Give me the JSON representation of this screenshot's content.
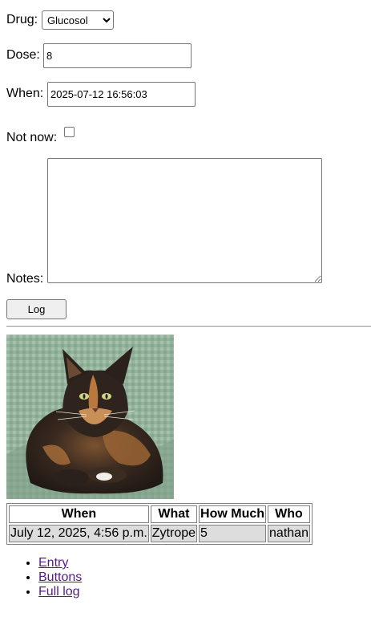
{
  "form": {
    "drug_label": "Drug:",
    "drug_selected": "Glucosol",
    "dose_label": "Dose:",
    "dose_value": "8",
    "when_label": "When:",
    "when_value": "2025-07-12 16:56:03",
    "not_now_label": "Not now:",
    "not_now_checked": false,
    "notes_label": "Notes:",
    "notes_value": "",
    "log_button": "Log"
  },
  "photo": {
    "subject": "tortoiseshell long-haired cat on a green blanket",
    "colors": {
      "blanket": "#8fae98",
      "fur_dark": "#2a211c",
      "fur_orange": "#b9793e",
      "fur_light": "#f3efe8",
      "eyes": "#cfd58a"
    }
  },
  "log_table": {
    "headers": [
      "When",
      "What",
      "How Much",
      "Who"
    ],
    "rows": [
      [
        "July 12, 2025, 4:56 p.m.",
        "Zytrope",
        "5",
        "nathan"
      ]
    ]
  },
  "nav": {
    "links": [
      "Entry",
      "Buttons",
      "Full log"
    ]
  },
  "colors": {
    "link": "#551a8b",
    "cell_bg": "#dddddd",
    "button_bg": "#efefef"
  }
}
